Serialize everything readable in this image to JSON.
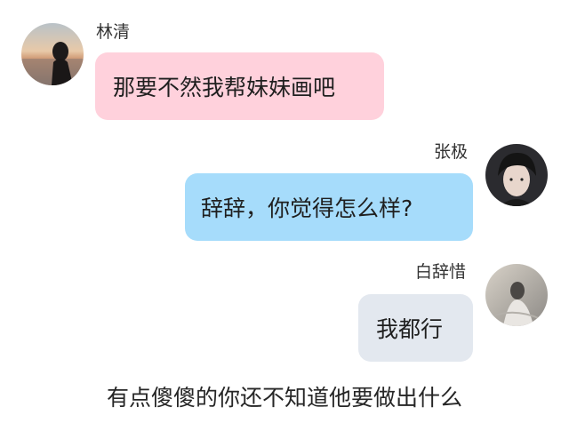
{
  "messages": [
    {
      "sender": "林清",
      "text": "那要不然我帮妹妹画吧",
      "side": "left",
      "color": "#ffd1dc"
    },
    {
      "sender": "张极",
      "text": "辞辞，你觉得怎么样?",
      "side": "right",
      "color": "#a6dcfb"
    },
    {
      "sender": "白辞惜",
      "text": "我都行",
      "side": "right",
      "color": "#e3e8ef"
    }
  ],
  "caption": "有点傻傻的你还不知道他要做出什么",
  "avatars": [
    {
      "icon": "sunset-portrait-avatar-icon"
    },
    {
      "icon": "dark-hair-portrait-avatar-icon"
    },
    {
      "icon": "pale-portrait-avatar-icon"
    }
  ]
}
